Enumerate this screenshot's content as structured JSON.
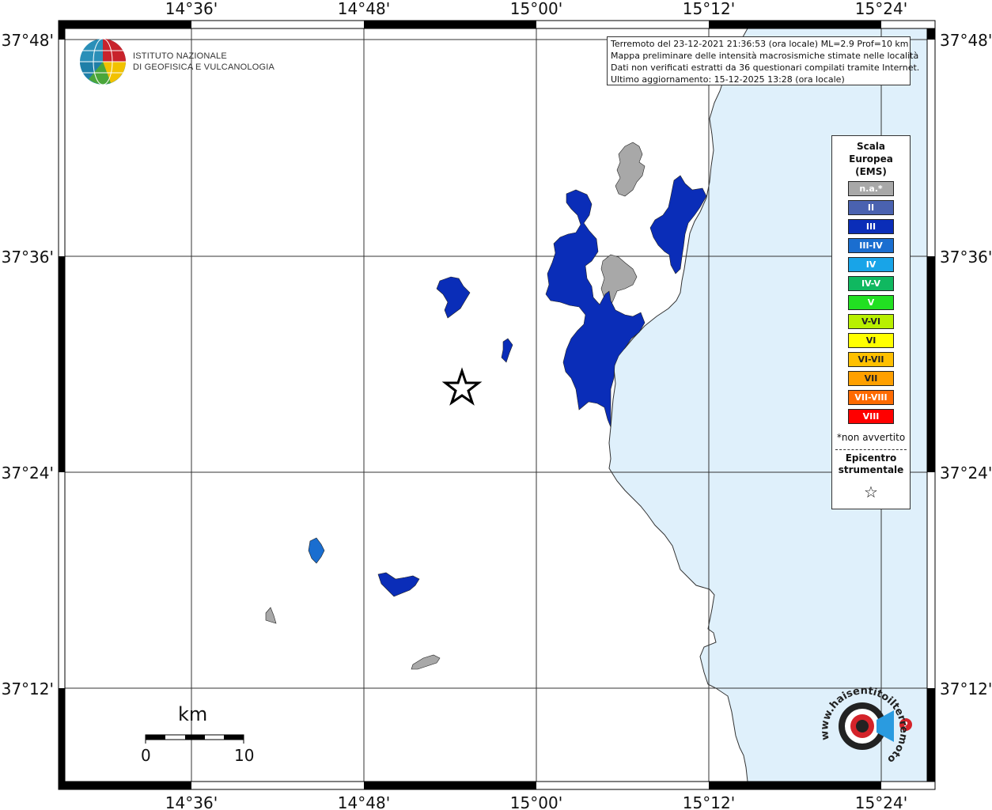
{
  "map": {
    "lon_ticks": [
      "14°36'",
      "14°48'",
      "15°00'",
      "15°12'",
      "15°24'"
    ],
    "lat_ticks": [
      "37°48'",
      "37°36'",
      "37°24'",
      "37°12'"
    ],
    "sea_color": "#dff0fb",
    "land_color": "#ffffff",
    "graticule_color": "#333333"
  },
  "institute": {
    "line1": "ISTITUTO NAZIONALE",
    "line2": "DI GEOFISICA E VULCANOLOGIA"
  },
  "info": {
    "line1": "Terremoto del 23-12-2021 21:36:53 (ora locale) ML=2.9 Prof=10 km",
    "line2": "Mappa preliminare delle intensità macrosismiche stimate nelle località",
    "line3": "Dati non verificati estratti da 36 questionari compilati tramite Internet.",
    "line4": "Ultimo aggiornamento: 15-12-2025 13:28 (ora locale)"
  },
  "legend": {
    "title1": "Scala",
    "title2": "Europea",
    "title3": "(EMS)",
    "items": [
      {
        "label": "n.a.*",
        "color": "#a8a8a8"
      },
      {
        "label": "II",
        "color": "#4a62b0"
      },
      {
        "label": "III",
        "color": "#0a2db8"
      },
      {
        "label": "III-IV",
        "color": "#1a6ed0"
      },
      {
        "label": "IV",
        "color": "#18a4e8"
      },
      {
        "label": "IV-V",
        "color": "#10b860"
      },
      {
        "label": "V",
        "color": "#22e022"
      },
      {
        "label": "V-VI",
        "color": "#b8f000"
      },
      {
        "label": "VI",
        "color": "#ffff00"
      },
      {
        "label": "VI-VII",
        "color": "#ffc000"
      },
      {
        "label": "VII",
        "color": "#ffa000"
      },
      {
        "label": "VII-VIII",
        "color": "#ff6a00"
      },
      {
        "label": "VIII",
        "color": "#ff0000"
      }
    ],
    "note": "*non avvertito",
    "epicentre1": "Epicentro",
    "epicentre2": "strumentale",
    "star": "☆"
  },
  "scalebar": {
    "unit": "km",
    "start": "0",
    "end": "10"
  },
  "watermark": {
    "text": "www.haisentitoilterremoto.it",
    "mark": "?"
  }
}
